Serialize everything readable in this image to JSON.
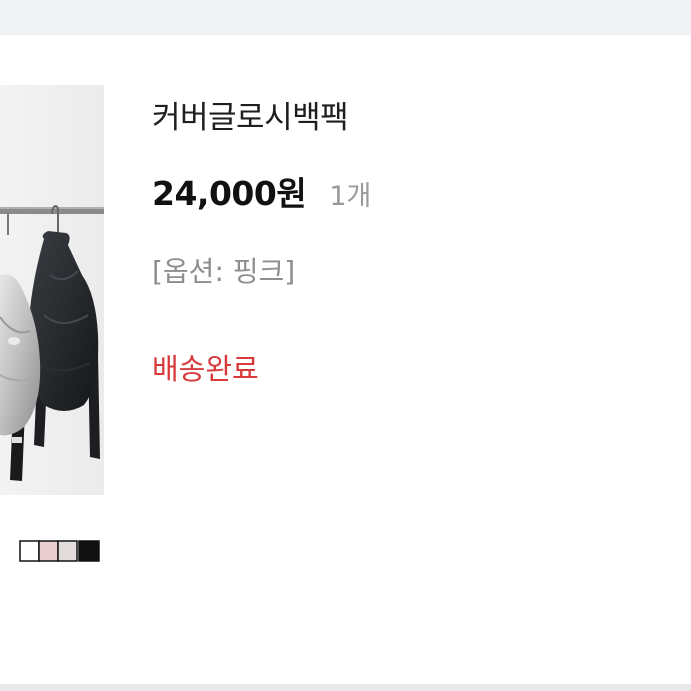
{
  "product": {
    "name": "커버글로시백팩",
    "price": "24,000원",
    "quantity": "1개",
    "option": "[옵션: 핑크]",
    "status": "배송완료",
    "thumbnail": {
      "icon": "backpack-photo",
      "swatches": [
        "#ffffff",
        "#e9cfd2",
        "#e2dcdd",
        "#111111"
      ]
    }
  },
  "colors": {
    "status": "#d63a3a",
    "price": "#111111",
    "muted": "#9a9a9a",
    "page_band": "#f1f3f5"
  }
}
